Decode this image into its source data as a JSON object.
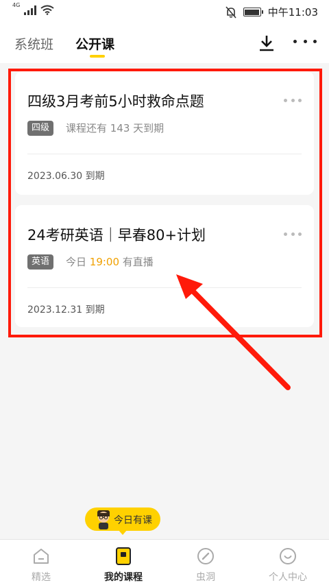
{
  "status_bar": {
    "network": "4G",
    "time": "中午11:03"
  },
  "tabs": [
    {
      "label": "系统班",
      "active": false
    },
    {
      "label": "公开课",
      "active": true
    }
  ],
  "courses": [
    {
      "title": "四级3月考前5小时救命点题",
      "tag": "四级",
      "info": "课程还有 143 天到期",
      "expire": "2023.06.30 到期"
    },
    {
      "title": "24考研英语｜早春80+计划",
      "tag": "英语",
      "info_before": "今日 ",
      "info_highlight": "19:00",
      "info_after": " 有直播",
      "expire": "2023.12.31 到期"
    }
  ],
  "today_badge": "今日有课",
  "bottom_nav": [
    {
      "label": "精选",
      "icon": "home-icon",
      "active": false
    },
    {
      "label": "我的课程",
      "icon": "my-courses-icon",
      "active": true
    },
    {
      "label": "虫洞",
      "icon": "compass-icon",
      "active": false
    },
    {
      "label": "个人中心",
      "icon": "smile-face-icon",
      "active": false
    }
  ],
  "colors": {
    "accent_yellow": "#ffd100",
    "highlight_orange": "#f0a000",
    "annotation_red": "#ff1a0a",
    "tag_gray": "#707070"
  }
}
